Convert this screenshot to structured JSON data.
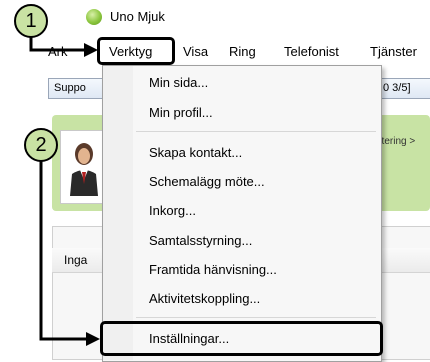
{
  "window": {
    "title": "Uno Mjuk",
    "logo_icon": "uno-mjuk-logo-icon"
  },
  "menu": {
    "items": [
      {
        "label": "Arkiv",
        "shown": "Ark"
      },
      {
        "label": "Verktyg"
      },
      {
        "label": "Visa"
      },
      {
        "label": "Ring"
      },
      {
        "label": "Telefonist"
      },
      {
        "label": "Tjänster"
      }
    ]
  },
  "toolbar": {
    "support_label": "Suppo",
    "count_label": "0 3/5]"
  },
  "status": {
    "text": "ptering >"
  },
  "list": {
    "header_label": "Inga"
  },
  "dropdown": {
    "items": [
      "Min sida...",
      "Min profil...",
      "Skapa kontakt...",
      "Schemalägg möte...",
      "Inkorg...",
      "Samtalsstyrning...",
      "Framtida hänvisning...",
      "Aktivitetskoppling...",
      "Inställningar..."
    ]
  },
  "callouts": {
    "one": "1",
    "two": "2"
  },
  "colors": {
    "callout_fill": "#c9e2a3",
    "panel_green": "#c8e3a4",
    "logo_green": "#8cc63f"
  }
}
